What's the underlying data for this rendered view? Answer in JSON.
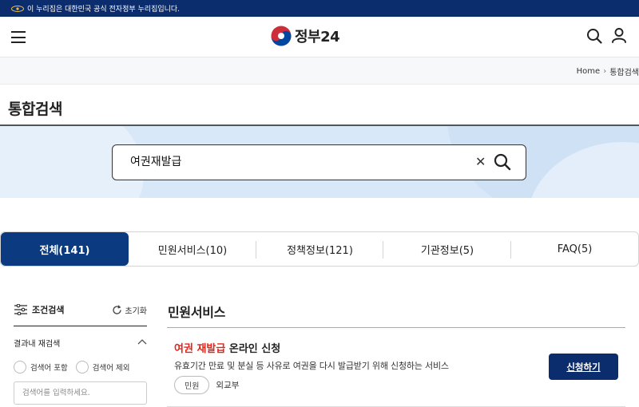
{
  "gov_banner": {
    "text": "이 누리집은 대한민국 공식 전자정부 누리집입니다."
  },
  "header": {
    "logo_text": "정부24"
  },
  "breadcrumb": {
    "items": [
      "Home",
      "통합검색"
    ]
  },
  "page": {
    "title": "통합검색"
  },
  "search": {
    "value": "여권재발급"
  },
  "tabs": [
    {
      "label": "전체(141)",
      "active": true
    },
    {
      "label": "민원서비스(10)",
      "active": false
    },
    {
      "label": "정책정보(121)",
      "active": false
    },
    {
      "label": "기관정보(5)",
      "active": false
    },
    {
      "label": "FAQ(5)",
      "active": false
    }
  ],
  "filter": {
    "title": "조건검색",
    "reset_label": "초기화",
    "refine_title": "결과내 재검색",
    "include_label": "검색어 포함",
    "exclude_label": "검색어 제외",
    "input_placeholder": "검색어를 입력하세요."
  },
  "results": {
    "section_title": "민원서비스",
    "items": [
      {
        "title_highlight": "여권 재발급",
        "title_rest": " 온라인 신청",
        "description": "유효기간 만료 및 분실 등 사유로 여권을 다시 발급받기 위해 신청하는 서비스",
        "tag": "민원",
        "agency": "외교부",
        "action_label": "신청하기"
      }
    ]
  },
  "colors": {
    "brand_navy": "#0b2d6e",
    "tab_active": "#0b3a80",
    "highlight_red": "#e1251b",
    "search_band": "#d8e8f8"
  }
}
